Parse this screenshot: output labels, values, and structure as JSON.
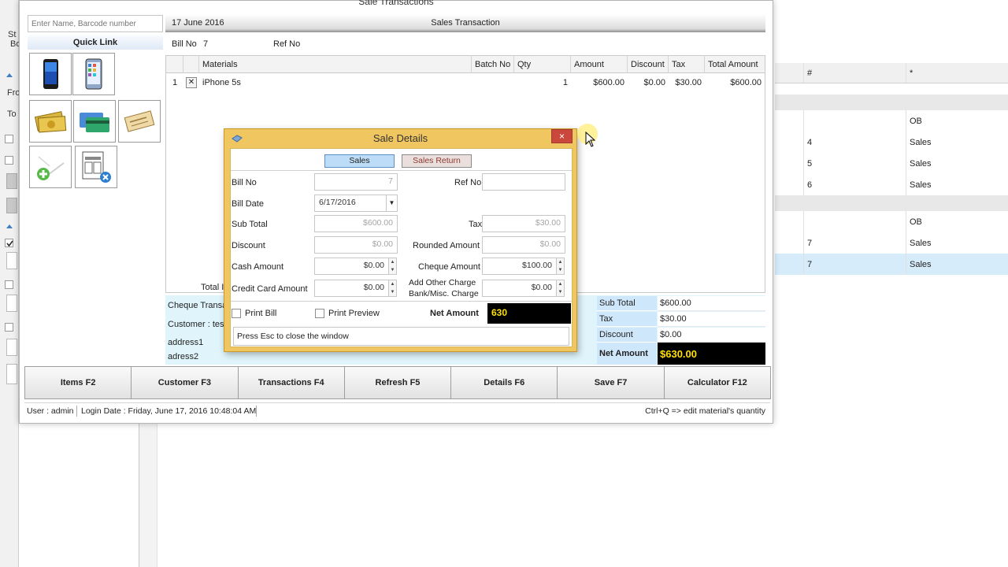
{
  "window": {
    "title": "Sale Transactions"
  },
  "background": {
    "left_cut": [
      "St",
      "Bo",
      "Fro",
      "To"
    ],
    "grid": {
      "headers": [
        "#",
        "*"
      ],
      "rows": [
        {
          "num": "",
          "type": "OB"
        },
        {
          "num": "4",
          "type": "Sales"
        },
        {
          "num": "5",
          "type": "Sales"
        },
        {
          "num": "6",
          "type": "Sales"
        },
        {
          "num": "",
          "type": "OB"
        },
        {
          "num": "7",
          "type": "Sales"
        },
        {
          "num": "7",
          "type": "Sales"
        }
      ]
    }
  },
  "sidebar": {
    "search_placeholder": "Enter Name, Barcode number",
    "quick_link": "Quick Link",
    "tiles": [
      {
        "icon": "phone-icon"
      },
      {
        "icon": "phone-screen-icon"
      },
      {
        "icon": "cash-icon"
      },
      {
        "icon": "credit-card-icon"
      },
      {
        "icon": "cheque-icon"
      },
      {
        "icon": "add-item-icon"
      },
      {
        "icon": "cancel-invoice-icon"
      }
    ]
  },
  "header": {
    "date": "17 June 2016",
    "title": "Sales Transaction"
  },
  "billrow": {
    "bill_label": "Bill No",
    "bill_value": "7",
    "ref_label": "Ref No"
  },
  "grid": {
    "headers": [
      "Materials",
      "Batch No",
      "Qty",
      "Amount",
      "Discount",
      "Tax",
      "Total Amount"
    ],
    "rows": [
      {
        "index": "1",
        "material": "iPhone 5s",
        "batch": "",
        "qty": "1",
        "amount": "$600.00",
        "discount": "$0.00",
        "tax": "$30.00",
        "total": "$600.00"
      }
    ]
  },
  "info": {
    "total_cut": "Total It",
    "cheque_cut": "Cheque Transac",
    "customer_cut": "Customer :  tes",
    "address1": "address1",
    "address2": "adress2"
  },
  "totals": {
    "sub_total_label": "Sub Total",
    "sub_total": "$600.00",
    "tax_label": "Tax",
    "tax": "$30.00",
    "discount_label": "Discount",
    "discount": "$0.00",
    "net_label": "Net Amount",
    "net": "$630.00"
  },
  "fkeys": [
    "Items F2",
    "Customer F3",
    "Transactions F4",
    "Refresh F5",
    "Details F6",
    "Save F7",
    "Calculator F12"
  ],
  "status": {
    "user": "User : admin",
    "login": "Login Date : Friday, June 17, 2016 10:48:04 AM",
    "hint": "Ctrl+Q => edit material's quantity"
  },
  "modal": {
    "title": "Sale Details",
    "close": "×",
    "tabs": {
      "sales": "Sales",
      "sales_return": "Sales Return"
    },
    "bill_no_label": "Bill No",
    "bill_no": "7",
    "ref_no_label": "Ref No",
    "ref_no": "",
    "bill_date_label": "Bill Date",
    "bill_date": "6/17/2016",
    "sub_total_label": "Sub Total",
    "sub_total": "$600.00",
    "tax_label": "Tax",
    "tax": "$30.00",
    "discount_label": "Discount",
    "discount": "$0.00",
    "rounded_label": "Rounded Amount",
    "rounded": "$0.00",
    "cash_label": "Cash Amount",
    "cash": "$0.00",
    "cheque_label": "Cheque Amount",
    "cheque": "$100.00",
    "cc_label": "Credit Card Amount",
    "cc": "$0.00",
    "other_label_1": "Add Other Charge",
    "other_label_2": "Bank/Misc. Charge",
    "other": "$0.00",
    "print_bill": "Print Bill",
    "print_preview": "Print Preview",
    "net_label": "Net Amount",
    "net": "630",
    "esc_hint": "Press Esc to close the window"
  },
  "colors": {
    "modal_frame": "#f0c660",
    "net_bg": "#000000",
    "net_text": "#ffe000",
    "totals_label_bg": "#cfe7fb",
    "close_button": "#c9483b"
  }
}
